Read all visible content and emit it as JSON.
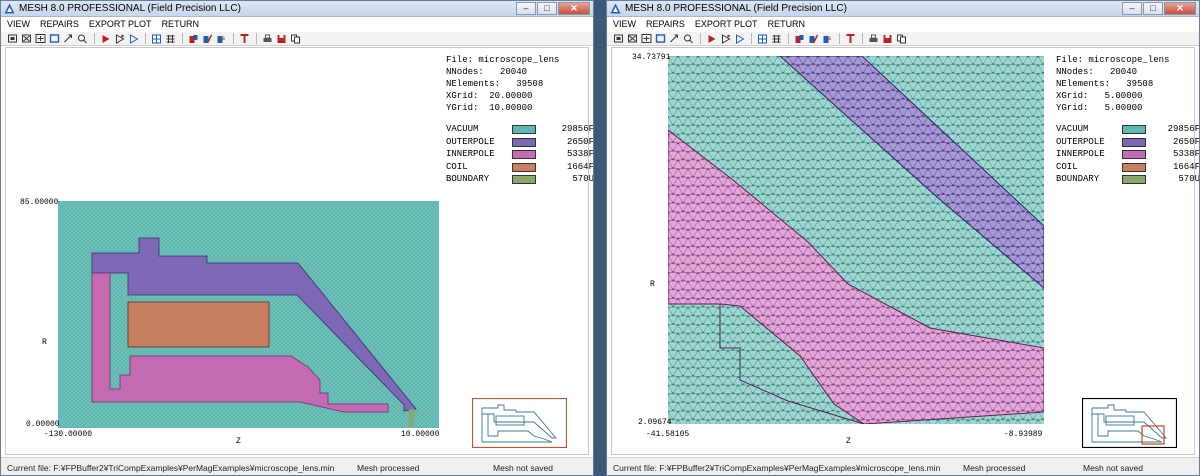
{
  "windows": [
    {
      "title": "MESH 8.0 PROFESSIONAL (Field Precision LLC)",
      "menu": [
        "VIEW",
        "REPAIRS",
        "EXPORT PLOT",
        "RETURN"
      ],
      "info": {
        "file": "File: microscope_lens",
        "nnodes": "NNodes:   20040",
        "nelements": "NElements:   39508",
        "xgrid": "XGrid:  20.00000",
        "ygrid": "YGrid:  10.00000"
      },
      "plot": {
        "ymax": "85.00000",
        "ymin": "0.00000",
        "xmin": "-130.00000",
        "xmax": "10.00000",
        "xlabel": "Z",
        "ylabel": "R"
      },
      "status": {
        "file": "Current file: F:¥FPBuffer2¥TriCompExamples¥PerMagExamples¥microscope_lens.min",
        "mesh": "Mesh processed",
        "saved": "Mesh not saved"
      }
    },
    {
      "title": "MESH 8.0 PROFESSIONAL (Field Precision LLC)",
      "menu": [
        "VIEW",
        "REPAIRS",
        "EXPORT PLOT",
        "RETURN"
      ],
      "info": {
        "file": "File: microscope_lens",
        "nnodes": "NNodes:   20040",
        "nelements": "NElements:   39508",
        "xgrid": "XGrid:   5.00000",
        "ygrid": "YGrid:   5.00000"
      },
      "plot": {
        "ymax": "34.73791",
        "ymin": "2.09674",
        "xmin": "-41.58105",
        "xmax": "-8.93989",
        "xlabel": "Z",
        "ylabel": "R"
      },
      "status": {
        "file": "Current file: F:¥FPBuffer2¥TriCompExamples¥PerMagExamples¥microscope_lens.min",
        "mesh": "Mesh processed",
        "saved": "Mesh not saved"
      }
    }
  ],
  "legend": [
    {
      "name": "VACUUM",
      "count": "29856F",
      "color": "#5fb8b0"
    },
    {
      "name": "OUTERPOLE",
      "count": "2650F",
      "color": "#7c68b4"
    },
    {
      "name": "INNERPOLE",
      "count": "5338F",
      "color": "#c46bb4"
    },
    {
      "name": "COIL",
      "count": "1664F",
      "color": "#c88060"
    },
    {
      "name": "BOUNDARY",
      "count": "570U",
      "color": "#8aa870"
    }
  ],
  "icons": [
    "zoom-window-icon",
    "zoom-out-icon",
    "zoom-full-icon",
    "zoom-fit-icon",
    "pan-icon",
    "query-icon",
    "arrow-icon",
    "move-icon",
    "select-icon",
    "grid-icon",
    "table-icon",
    "region-icon",
    "material-icon",
    "node-icon",
    "text-icon",
    "print-icon",
    "save-icon",
    "copy-icon"
  ]
}
